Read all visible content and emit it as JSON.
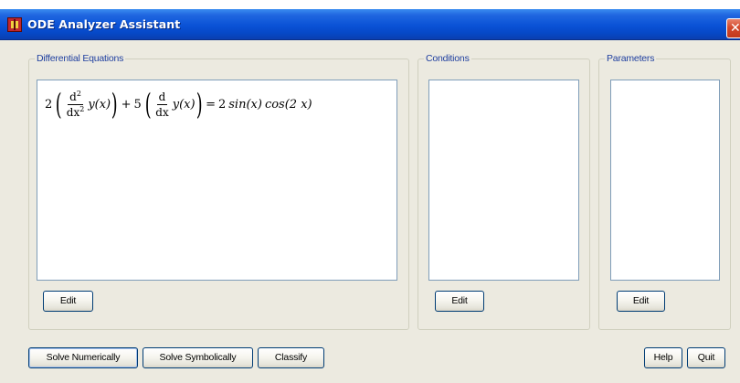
{
  "window": {
    "title": "ODE Analyzer Assistant",
    "close_glyph": "✕"
  },
  "groups": {
    "differential_equations": {
      "legend": "Differential Equations",
      "equation": {
        "lhs_coef1": "2",
        "frac1_num": "d",
        "frac1_num_exp": "2",
        "frac1_den": "dx",
        "frac1_den_exp": "2",
        "func1": "y(x)",
        "plus": "+",
        "lhs_coef2": "5",
        "frac2_num": "d",
        "frac2_den": "dx",
        "func2": "y(x)",
        "equals": "=",
        "rhs_coef": "2",
        "rhs_sin": "sin(x)",
        "rhs_cos": "cos(2 x)"
      },
      "edit_label": "Edit"
    },
    "conditions": {
      "legend": "Conditions",
      "edit_label": "Edit"
    },
    "parameters": {
      "legend": "Parameters",
      "edit_label": "Edit"
    }
  },
  "actions": {
    "solve_numerically": "Solve Numerically",
    "solve_symbolically": "Solve Symbolically",
    "classify": "Classify",
    "help": "Help",
    "quit": "Quit"
  }
}
